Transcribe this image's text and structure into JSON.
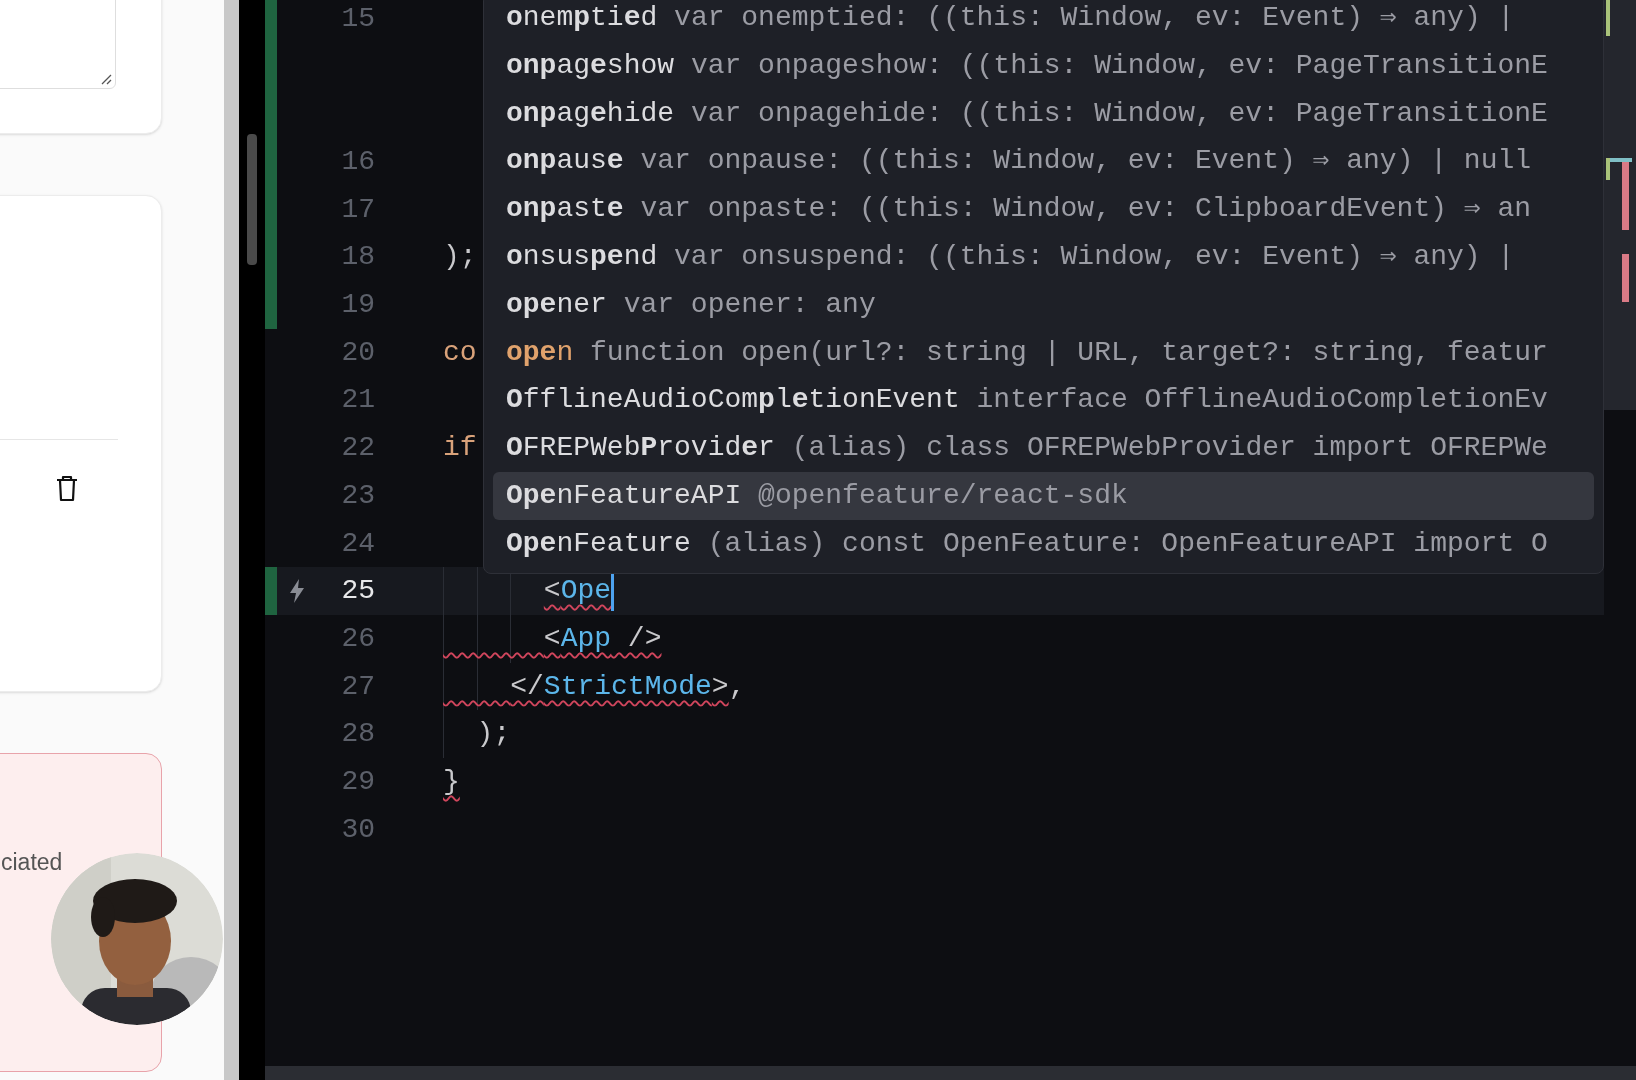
{
  "sidebar_panel": {
    "alert_text": "ciated"
  },
  "editor": {
    "lines": [
      {
        "number": "15",
        "changed": true,
        "current": false,
        "wrapped": true,
        "lightning": false,
        "cursor": false
      },
      {
        "number": "16",
        "changed": true,
        "current": false,
        "wrapped": false,
        "lightning": false,
        "cursor": false
      },
      {
        "number": "17",
        "changed": true,
        "current": false,
        "wrapped": false,
        "lightning": false,
        "cursor": false
      },
      {
        "number": "18",
        "changed": true,
        "current": false,
        "wrapped": false,
        "lightning": false,
        "cursor": false,
        "code": [
          {
            "text": ");",
            "kind": "punct",
            "error": false
          }
        ]
      },
      {
        "number": "19",
        "changed": true,
        "current": false,
        "wrapped": false,
        "lightning": false,
        "cursor": false
      },
      {
        "number": "20",
        "changed": false,
        "current": false,
        "wrapped": false,
        "lightning": false,
        "cursor": false,
        "code": [
          {
            "text": "co",
            "kind": "keyword",
            "error": false
          }
        ]
      },
      {
        "number": "21",
        "changed": false,
        "current": false,
        "wrapped": false,
        "lightning": false,
        "cursor": false
      },
      {
        "number": "22",
        "changed": false,
        "current": false,
        "wrapped": false,
        "lightning": false,
        "cursor": false,
        "code": [
          {
            "text": "if",
            "kind": "keyword",
            "error": false
          }
        ]
      },
      {
        "number": "23",
        "changed": false,
        "current": false,
        "wrapped": false,
        "lightning": false,
        "cursor": false
      },
      {
        "number": "24",
        "changed": false,
        "current": false,
        "wrapped": false,
        "lightning": false,
        "cursor": false
      },
      {
        "number": "25",
        "changed": true,
        "current": true,
        "wrapped": false,
        "lightning": true,
        "cursor": true,
        "kind": "nested3",
        "indent_squiggle": false,
        "code": [
          {
            "text": "<",
            "kind": "punct",
            "error": true
          },
          {
            "text": "Ope",
            "kind": "tag",
            "error": true
          }
        ]
      },
      {
        "number": "26",
        "changed": false,
        "current": false,
        "wrapped": false,
        "lightning": false,
        "cursor": false,
        "kind": "nested3",
        "indent_squiggle": true,
        "code": [
          {
            "text": "<",
            "kind": "punct",
            "error": true
          },
          {
            "text": "App",
            "kind": "tag",
            "error": true
          },
          {
            "text": " />",
            "kind": "punct",
            "error": true
          }
        ]
      },
      {
        "number": "27",
        "changed": false,
        "current": false,
        "wrapped": false,
        "lightning": false,
        "cursor": false,
        "kind": "nested2",
        "indent_squiggle": true,
        "code": [
          {
            "text": "</",
            "kind": "punct",
            "error": true
          },
          {
            "text": "StrictMode",
            "kind": "tag",
            "error": true
          },
          {
            "text": ">",
            "kind": "punct",
            "error": true
          },
          {
            "text": ",",
            "kind": "punct",
            "error": false
          }
        ]
      },
      {
        "number": "28",
        "changed": false,
        "current": false,
        "wrapped": false,
        "lightning": false,
        "cursor": false,
        "kind": "nested1",
        "indent_squiggle": false,
        "code": [
          {
            "text": ");",
            "kind": "punct",
            "error": false
          }
        ]
      },
      {
        "number": "29",
        "changed": false,
        "current": false,
        "wrapped": false,
        "lightning": false,
        "cursor": false,
        "code": [
          {
            "text": "}",
            "kind": "punct",
            "error": true
          }
        ]
      },
      {
        "number": "30",
        "changed": false,
        "current": false,
        "wrapped": false,
        "lightning": false,
        "cursor": false
      }
    ],
    "autocomplete": {
      "items": [
        {
          "label": "**o**nem**p**ti**e**d",
          "detail": "var onemptied: ((this: Window, ev: Event) ⇒ any) |",
          "kind": "var",
          "selected": false
        },
        {
          "label": "**onp**ag**e**show",
          "detail": "var onpageshow: ((this: Window, ev: PageTransitionE",
          "kind": "var",
          "selected": false
        },
        {
          "label": "**onp**ag**e**hide",
          "detail": "var onpagehide: ((this: Window, ev: PageTransitionE",
          "kind": "var",
          "selected": false
        },
        {
          "label": "**onp**aus**e**",
          "detail": "var onpause: ((this: Window, ev: Event) ⇒ any) | null",
          "kind": "var",
          "selected": false
        },
        {
          "label": "**onp**ast**e**",
          "detail": "var onpaste: ((this: Window, ev: ClipboardEvent) ⇒ an",
          "kind": "var",
          "selected": false
        },
        {
          "label": "**o**nsus**pe**nd",
          "detail": "var onsuspend: ((this: Window, ev: Event) ⇒ any) |",
          "kind": "var",
          "selected": false
        },
        {
          "label": "**ope**ner",
          "detail": "var opener: any",
          "kind": "var",
          "selected": false
        },
        {
          "label": "**ope**n",
          "detail": "function open(url?: string | URL, target?: string, featur",
          "kind": "function",
          "selected": false
        },
        {
          "label": "**O**fflineAudioCom**p**l**e**tionEvent",
          "detail": "interface OfflineAudioCompletionEv",
          "kind": "interface",
          "selected": false
        },
        {
          "label": "**O**FREPWeb**P**rovid**e**r",
          "detail": "(alias) class OFREPWebProvider import OFREPWe",
          "kind": "class",
          "selected": false
        },
        {
          "label": "**Ope**nFeatureAPI",
          "detail": "@openfeature/react-sdk",
          "kind": "module",
          "selected": true
        },
        {
          "label": "**Ope**nFeature",
          "detail": "(alias) const OpenFeature: OpenFeatureAPI import O",
          "kind": "const",
          "selected": false
        }
      ]
    }
  }
}
